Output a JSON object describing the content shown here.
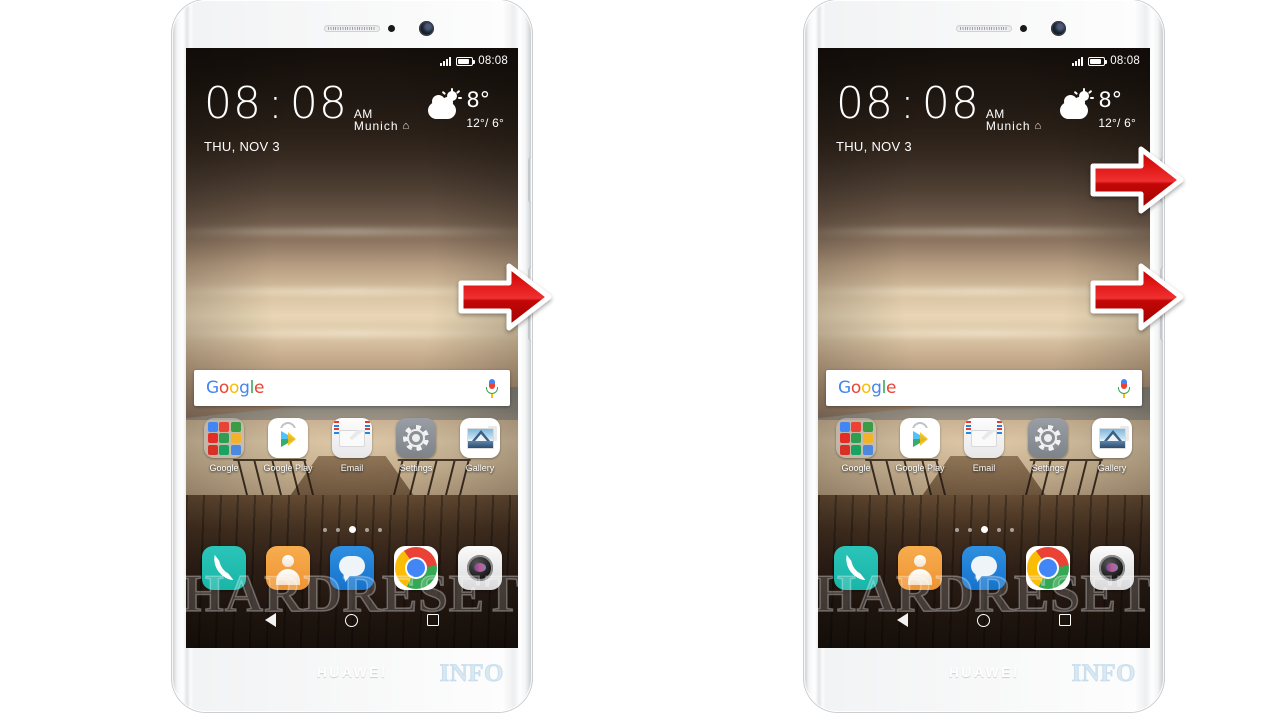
{
  "page": {
    "background": "#ffffff",
    "watermark": "HARDRESET",
    "watermark_suffix": "INFO"
  },
  "phones": [
    {
      "id": "phone-left",
      "brand": "HUAWEI"
    },
    {
      "id": "phone-right",
      "brand": "HUAWEI"
    }
  ],
  "status_bar": {
    "signal_icon": "signal-bars-icon",
    "battery_icon": "battery-icon",
    "time": "08:08"
  },
  "clock_widget": {
    "hours": "08",
    "separator": ":",
    "minutes": "08",
    "ampm": "AM",
    "city": "Munich",
    "home_icon": "home-icon",
    "date": "THU, NOV 3"
  },
  "weather_widget": {
    "icon": "partly-cloudy-icon",
    "current_temp": "8°",
    "range": "12°/ 6°"
  },
  "search_bar": {
    "logo": "Google",
    "logo_letters": [
      "G",
      "o",
      "o",
      "g",
      "l",
      "e"
    ],
    "mic_icon": "microphone-icon",
    "placeholder": ""
  },
  "app_grid": [
    {
      "label": "Google",
      "icon": "google-folder-icon"
    },
    {
      "label": "Google Play",
      "icon": "play-store-icon"
    },
    {
      "label": "Email",
      "icon": "email-icon"
    },
    {
      "label": "Settings",
      "icon": "settings-gear-icon"
    },
    {
      "label": "Gallery",
      "icon": "gallery-icon"
    }
  ],
  "page_indicator": {
    "count": 5,
    "active_index": 2
  },
  "dock": [
    {
      "label": "Phone",
      "icon": "phone-handset-icon"
    },
    {
      "label": "Contacts",
      "icon": "contacts-person-icon"
    },
    {
      "label": "Messages",
      "icon": "message-bubble-icon"
    },
    {
      "label": "Chrome",
      "icon": "chrome-icon"
    },
    {
      "label": "Camera",
      "icon": "camera-lens-icon"
    }
  ],
  "nav_bar": [
    {
      "label": "Back",
      "icon": "back-triangle-icon"
    },
    {
      "label": "Home",
      "icon": "home-circle-icon"
    },
    {
      "label": "Recent",
      "icon": "recents-square-icon"
    }
  ],
  "hardware": {
    "earpiece": "earpiece-speaker",
    "sensor": "proximity-sensor",
    "front_camera": "front-camera",
    "power_button": "power-button",
    "volume_button": "volume-button"
  },
  "annotations": [
    {
      "id": "arrow-left-phone-power",
      "icon": "red-arrow-right-icon",
      "target": "power-button",
      "phone": "phone-left"
    },
    {
      "id": "arrow-right-phone-power",
      "icon": "red-arrow-right-icon",
      "target": "power-button",
      "phone": "phone-right"
    },
    {
      "id": "arrow-right-phone-volume",
      "icon": "red-arrow-right-icon",
      "target": "volume-button",
      "phone": "phone-right"
    }
  ],
  "colors": {
    "arrow_fill": "#d40d0d",
    "arrow_stroke": "#ffffff",
    "accent_blue": "#4285F4",
    "accent_red": "#EA4335",
    "accent_yellow": "#FBBC05",
    "accent_green": "#34A853"
  }
}
